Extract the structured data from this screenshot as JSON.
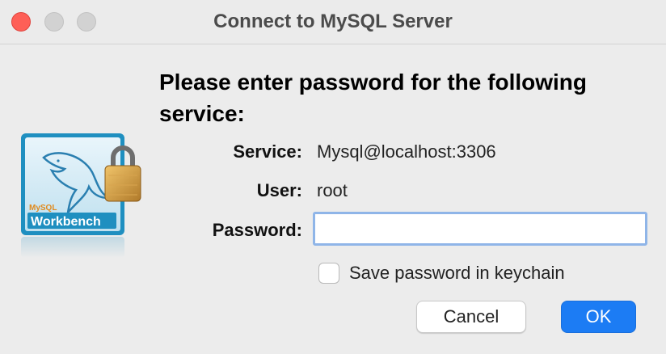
{
  "window": {
    "title": "Connect to MySQL Server",
    "controls": [
      "close",
      "minimize",
      "zoom"
    ]
  },
  "app_icon": {
    "name": "mysql-workbench-icon",
    "brand_text_small": "MySQL",
    "brand_text": "Workbench",
    "badge": "lock-icon"
  },
  "prompt": {
    "heading": "Please enter password for the following service:"
  },
  "form": {
    "service_label": "Service:",
    "service_value": "Mysql@localhost:3306",
    "user_label": "User:",
    "user_value": "root",
    "password_label": "Password:",
    "password_value": "",
    "save_keychain_label": "Save password in keychain",
    "save_keychain_checked": false
  },
  "buttons": {
    "cancel": "Cancel",
    "ok": "OK"
  },
  "colors": {
    "accent": "#1c7cf4",
    "focus_ring": "#8fb5e8",
    "close_light": "#fe5f57"
  }
}
